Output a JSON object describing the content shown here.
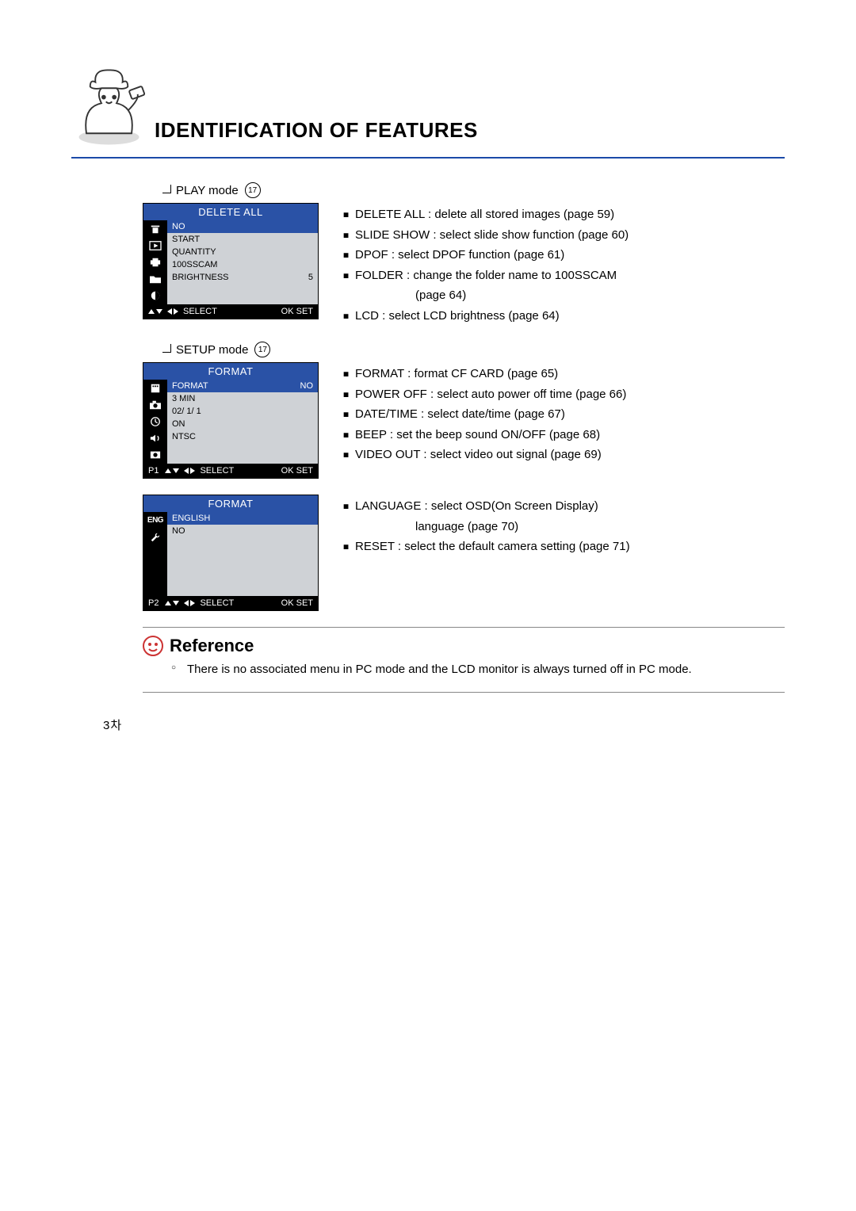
{
  "title": "IDENTIFICATION OF FEATURES",
  "sections": {
    "play": {
      "label": "PLAY mode",
      "circle": "17",
      "screen": {
        "title": "DELETE ALL",
        "rows": [
          {
            "l": "NO",
            "r": "",
            "sel": true,
            "icon": "trash-icon"
          },
          {
            "l": "START",
            "r": "",
            "icon": "play-icon"
          },
          {
            "l": "QUANTITY",
            "r": "",
            "icon": "print-icon"
          },
          {
            "l": "100SSCAM",
            "r": "",
            "icon": "folder-icon"
          },
          {
            "l": "BRIGHTNESS",
            "r": "5",
            "icon": "contrast-icon"
          }
        ],
        "footer": {
          "pg": "",
          "select": "SELECT",
          "ok": "OK SET"
        }
      },
      "desc": [
        "DELETE ALL : delete all stored images (page 59)",
        "SLIDE SHOW : select slide show function (page 60)",
        "DPOF : select DPOF function (page 61)",
        "FOLDER : change the folder name to 100SSCAM",
        "(page 64)",
        "LCD : select LCD brightness (page 64)"
      ]
    },
    "setup": {
      "label": "SETUP mode",
      "circle": "17",
      "screen1": {
        "title": "FORMAT",
        "rows": [
          {
            "l": "FORMAT",
            "r": "NO",
            "sel": true,
            "icon": "card-icon"
          },
          {
            "l": "3 MIN",
            "r": "",
            "icon": "camera-icon"
          },
          {
            "l": "02/  1/  1",
            "r": "",
            "icon": "clock-icon"
          },
          {
            "l": "ON",
            "r": "",
            "icon": "sound-icon"
          },
          {
            "l": "NTSC",
            "r": "",
            "icon": "video-out-icon"
          }
        ],
        "footer": {
          "pg": "P1",
          "select": "SELECT",
          "ok": "OK SET"
        }
      },
      "desc1": [
        "FORMAT : format CF CARD (page 65)",
        "POWER OFF : select auto power off time (page 66)",
        "DATE/TIME : select date/time (page 67)",
        "BEEP : set the beep sound ON/OFF (page 68)",
        "VIDEO OUT : select video out signal (page 69)"
      ],
      "screen2": {
        "title": "FORMAT",
        "rows": [
          {
            "l": "ENGLISH",
            "r": "",
            "sel": true,
            "icon": "eng-label"
          },
          {
            "l": "NO",
            "r": "",
            "icon": "wrench-icon"
          }
        ],
        "footer": {
          "pg": "P2",
          "select": "SELECT",
          "ok": "OK SET"
        }
      },
      "desc2": [
        "LANGUAGE : select OSD(On Screen Display)",
        "language (page 70)",
        "RESET : select the default camera setting (page 71)"
      ]
    }
  },
  "reference": {
    "heading": "Reference",
    "text": "There is no associated menu in PC mode and the LCD monitor is always turned off in PC mode."
  },
  "pagenum": "3차"
}
